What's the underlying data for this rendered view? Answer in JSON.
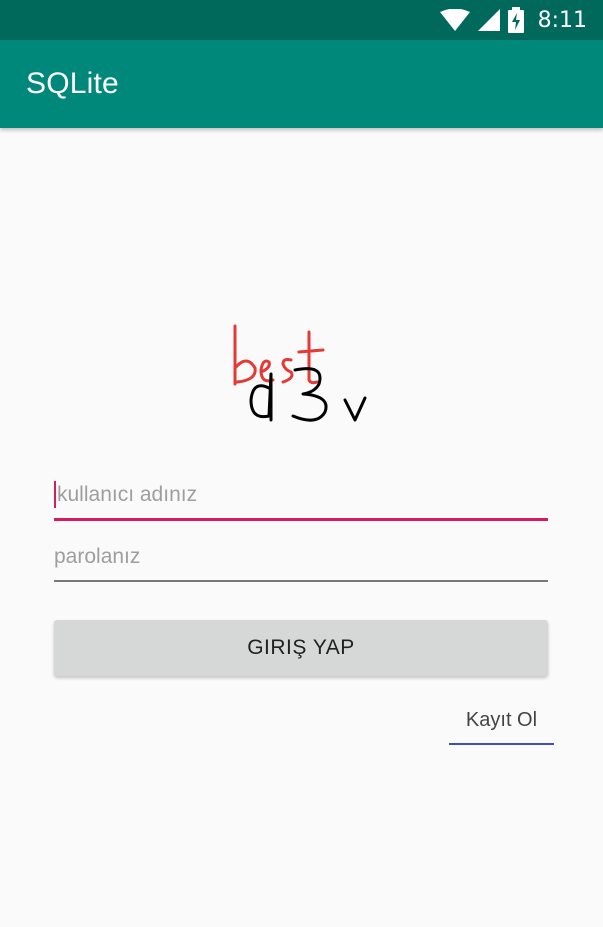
{
  "status_bar": {
    "time": "8:11",
    "icons": [
      "wifi-icon",
      "cell-signal-icon",
      "battery-charging-icon"
    ]
  },
  "app_bar": {
    "title": "SQLite",
    "color": "#00897b",
    "status_color": "#00695c"
  },
  "logo": {
    "top_text": "best",
    "bottom_text": "d3v",
    "top_color": "#e53935",
    "bottom_color": "#000000"
  },
  "form": {
    "username": {
      "placeholder": "kullanıcı adınız",
      "value": "",
      "accent": "#d81b60"
    },
    "password": {
      "placeholder": "parolanız",
      "value": ""
    },
    "login_label": "GIRIŞ YAP",
    "register_label": "Kayıt Ol",
    "register_accent": "#3f51b5"
  }
}
